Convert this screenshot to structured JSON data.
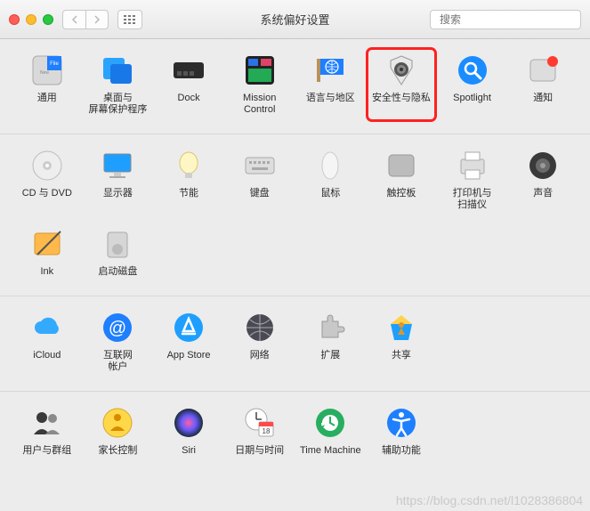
{
  "window": {
    "title": "系统偏好设置"
  },
  "search": {
    "placeholder": "搜索"
  },
  "sections": [
    {
      "items": [
        {
          "id": "general",
          "label": "通用"
        },
        {
          "id": "desktop",
          "label": "桌面与\n屏幕保护程序"
        },
        {
          "id": "dock",
          "label": "Dock"
        },
        {
          "id": "mission",
          "label": "Mission\nControl"
        },
        {
          "id": "lang",
          "label": "语言与地区"
        },
        {
          "id": "security",
          "label": "安全性与隐私",
          "highlight": true
        },
        {
          "id": "spotlight",
          "label": "Spotlight"
        },
        {
          "id": "notif",
          "label": "通知"
        }
      ]
    },
    {
      "items": [
        {
          "id": "cddvd",
          "label": "CD 与 DVD"
        },
        {
          "id": "display",
          "label": "显示器"
        },
        {
          "id": "energy",
          "label": "节能"
        },
        {
          "id": "keyboard",
          "label": "键盘"
        },
        {
          "id": "mouse",
          "label": "鼠标"
        },
        {
          "id": "trackpad",
          "label": "触控板"
        },
        {
          "id": "printer",
          "label": "打印机与\n扫描仪"
        },
        {
          "id": "sound",
          "label": "声音"
        },
        {
          "id": "ink",
          "label": "Ink"
        },
        {
          "id": "startup",
          "label": "启动磁盘"
        }
      ]
    },
    {
      "items": [
        {
          "id": "icloud",
          "label": "iCloud"
        },
        {
          "id": "internet",
          "label": "互联网\n帐户"
        },
        {
          "id": "appstore",
          "label": "App Store"
        },
        {
          "id": "network",
          "label": "网络"
        },
        {
          "id": "extensions",
          "label": "扩展"
        },
        {
          "id": "sharing",
          "label": "共享"
        }
      ]
    },
    {
      "items": [
        {
          "id": "users",
          "label": "用户与群组"
        },
        {
          "id": "parental",
          "label": "家长控制"
        },
        {
          "id": "siri",
          "label": "Siri"
        },
        {
          "id": "datetime",
          "label": "日期与时间"
        },
        {
          "id": "timemachine",
          "label": "Time Machine"
        },
        {
          "id": "accessibility",
          "label": "辅助功能"
        }
      ]
    }
  ],
  "watermark": "https://blog.csdn.net/l1028386804"
}
